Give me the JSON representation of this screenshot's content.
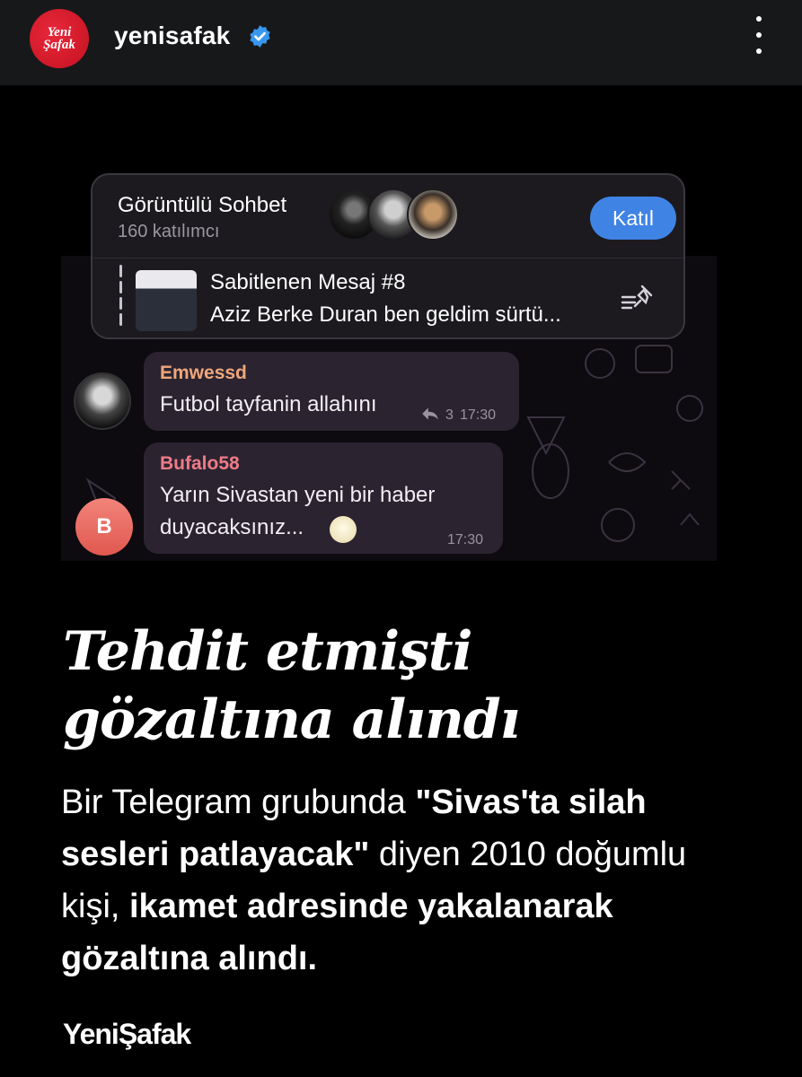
{
  "header": {
    "logo_line1": "Yeni",
    "logo_line2": "Şafak",
    "username": "yenisafak"
  },
  "chat_screenshot": {
    "video_chat": {
      "title": "Görüntülü Sohbet",
      "participants": "160 katılımcı",
      "join_label": "Katıl"
    },
    "pinned": {
      "title": "Sabitlenen Mesaj #8",
      "text": "Aziz Berke Duran ben geldim sürtü..."
    },
    "messages": [
      {
        "sender": "Emwessd",
        "text": "Futbol tayfanin allahını",
        "reply_count": "3",
        "time": "17:30"
      },
      {
        "sender": "Bufalo58",
        "avatar_letter": "B",
        "line1": "Yarın Sivastan yeni bir haber",
        "line2": "duyacaksınız...",
        "time": "17:30"
      }
    ]
  },
  "headline": {
    "line1": "Tehdit etmişti",
    "line2": "gözaltına alındı"
  },
  "lede": {
    "p1": "Bir Telegram grubunda ",
    "b1": "\"Sivas'ta silah sesleri patlayacak\"",
    "p2": " diyen 2010 doğumlu kişi, ",
    "b2": "ikamet adresinde yakalanarak gözaltına alındı."
  },
  "brand": "YeniŞafak",
  "colors": {
    "header_bg": "#17181a",
    "logo_red": "#d11a2a",
    "join_blue": "#3f84e5",
    "sender1": "#f0a77a",
    "sender2": "#ef7b88"
  }
}
